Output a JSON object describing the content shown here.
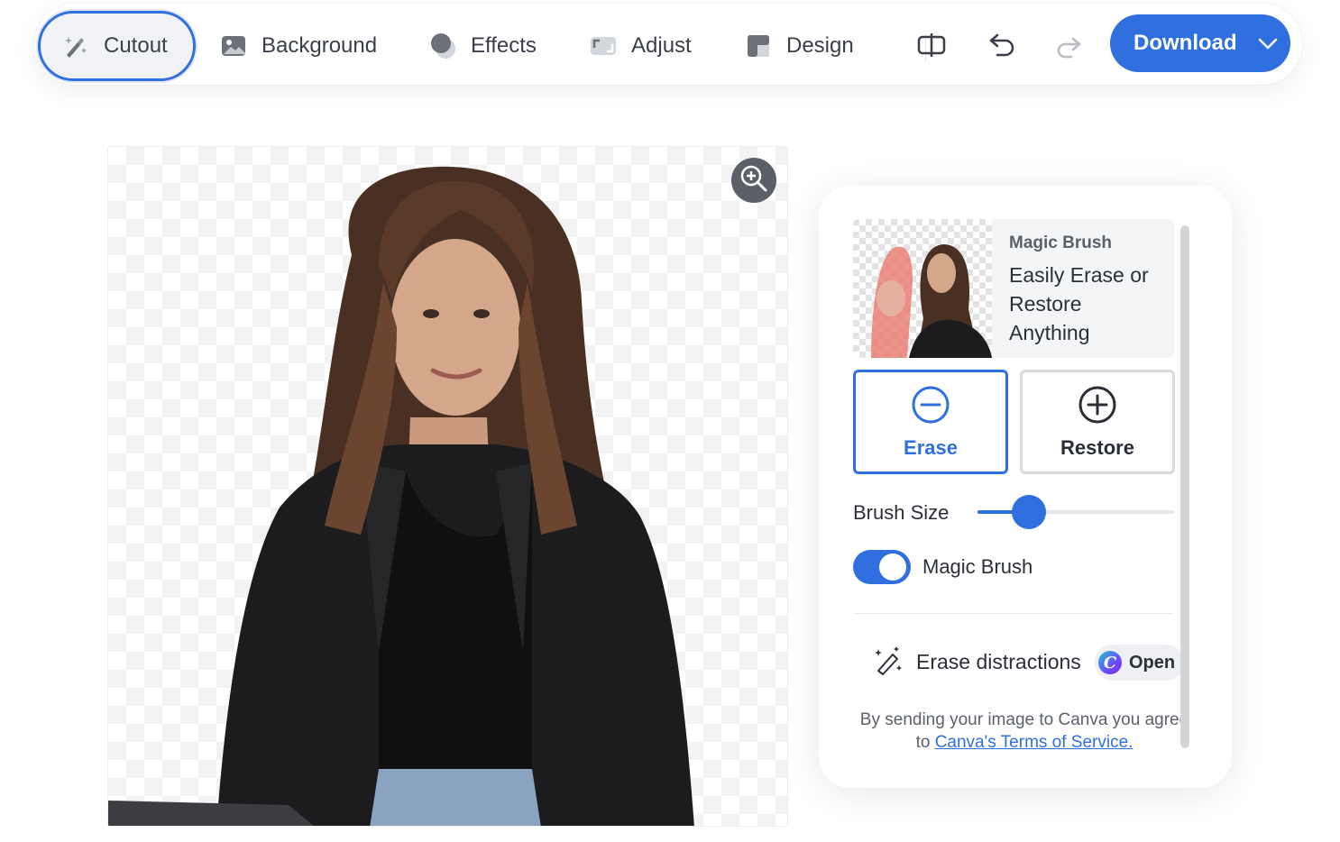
{
  "toolbar": {
    "tabs": [
      {
        "label": "Cutout",
        "icon": "magic-wand-icon",
        "active": true
      },
      {
        "label": "Background",
        "icon": "image-icon",
        "active": false
      },
      {
        "label": "Effects",
        "icon": "effects-icon",
        "active": false
      },
      {
        "label": "Adjust",
        "icon": "adjust-icon",
        "active": false
      },
      {
        "label": "Design",
        "icon": "design-icon",
        "active": false
      }
    ],
    "compare_icon": "compare-icon",
    "undo_icon": "undo-icon",
    "redo_icon": "redo-icon",
    "redo_enabled": false,
    "download_label": "Download"
  },
  "canvas": {
    "zoom_icon": "zoom-in-icon"
  },
  "panel": {
    "promo": {
      "kicker": "Magic Brush",
      "title": "Easily Erase or Restore Anything"
    },
    "erase_label": "Erase",
    "restore_label": "Restore",
    "selected_mode": "Erase",
    "brush_size_label": "Brush Size",
    "brush_size_fraction": 0.26,
    "magic_brush_label": "Magic Brush",
    "magic_brush_on": true,
    "erase_distractions_label": "Erase distractions",
    "open_label": "Open",
    "terms_text": "By sending your image to Canva you agree to",
    "terms_link": "Canva's Terms of Service."
  },
  "colors": {
    "accent": "#2f6fe0",
    "text": "#2b2f38",
    "muted": "#5b606b"
  }
}
